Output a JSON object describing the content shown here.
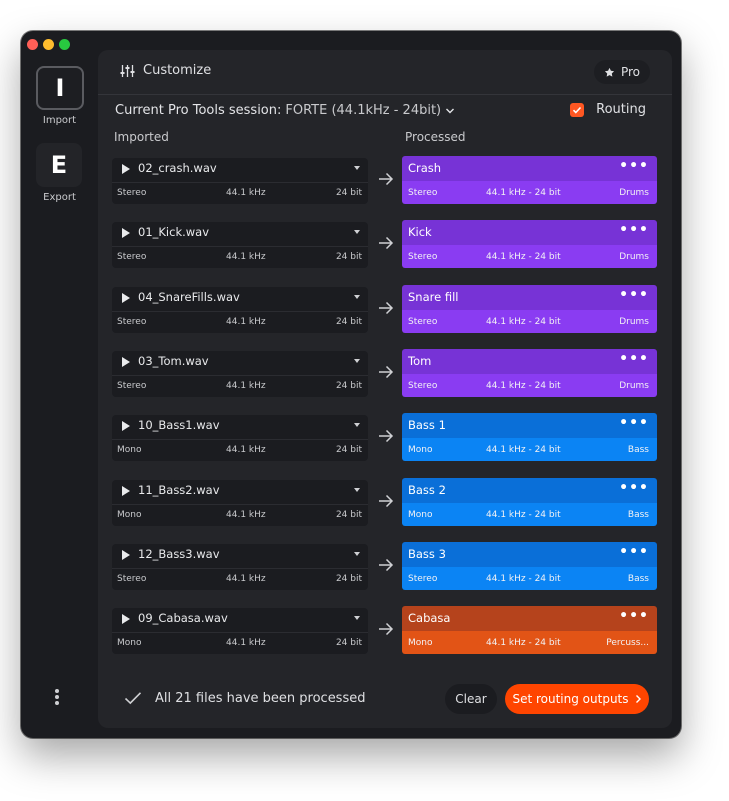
{
  "sidebar": {
    "import_glyph": "I",
    "import_label": "Import",
    "export_glyph": "E",
    "export_label": "Export",
    "more_icon": "vertical-dots"
  },
  "topbar": {
    "customize_label": "Customize",
    "customize_icon": "sliders-icon",
    "pro_label": "Pro",
    "pro_icon": "star-icon"
  },
  "session": {
    "label": "Current Pro Tools session:",
    "name": "FORTE (44.1kHz - 24bit)",
    "routing_label": "Routing",
    "routing_checked": true
  },
  "columns": {
    "imported": "Imported",
    "processed": "Processed"
  },
  "colors": {
    "drums_top": "#7733d6",
    "drums_bottom": "#8a3cf2",
    "bass_top": "#0a6fd8",
    "bass_bottom": "#0b84f4",
    "percussion_top": "#b5431c",
    "percussion_bottom": "#e25416",
    "accent": "#ff5722"
  },
  "rows": [
    {
      "file": "02_crash.wav",
      "ch": "Stereo",
      "rate": "44.1 kHz",
      "bits": "24 bit",
      "name": "Crash",
      "pch": "Stereo",
      "pfmt": "44.1 kHz - 24 bit",
      "group": "Drums",
      "color": "drums"
    },
    {
      "file": "01_Kick.wav",
      "ch": "Stereo",
      "rate": "44.1 kHz",
      "bits": "24 bit",
      "name": "Kick",
      "pch": "Stereo",
      "pfmt": "44.1 kHz - 24 bit",
      "group": "Drums",
      "color": "drums"
    },
    {
      "file": "04_SnareFills.wav",
      "ch": "Stereo",
      "rate": "44.1 kHz",
      "bits": "24 bit",
      "name": "Snare fill",
      "pch": "Stereo",
      "pfmt": "44.1 kHz - 24 bit",
      "group": "Drums",
      "color": "drums"
    },
    {
      "file": "03_Tom.wav",
      "ch": "Stereo",
      "rate": "44.1 kHz",
      "bits": "24 bit",
      "name": "Tom",
      "pch": "Stereo",
      "pfmt": "44.1 kHz - 24 bit",
      "group": "Drums",
      "color": "drums"
    },
    {
      "file": "10_Bass1.wav",
      "ch": "Mono",
      "rate": "44.1 kHz",
      "bits": "24 bit",
      "name": "Bass 1",
      "pch": "Mono",
      "pfmt": "44.1 kHz - 24 bit",
      "group": "Bass",
      "color": "bass"
    },
    {
      "file": "11_Bass2.wav",
      "ch": "Mono",
      "rate": "44.1 kHz",
      "bits": "24 bit",
      "name": "Bass 2",
      "pch": "Mono",
      "pfmt": "44.1 kHz - 24 bit",
      "group": "Bass",
      "color": "bass"
    },
    {
      "file": "12_Bass3.wav",
      "ch": "Stereo",
      "rate": "44.1 kHz",
      "bits": "24 bit",
      "name": "Bass 3",
      "pch": "Stereo",
      "pfmt": "44.1 kHz - 24 bit",
      "group": "Bass",
      "color": "bass"
    },
    {
      "file": "09_Cabasa.wav",
      "ch": "Mono",
      "rate": "44.1 kHz",
      "bits": "24 bit",
      "name": "Cabasa",
      "pch": "Mono",
      "pfmt": "44.1 kHz - 24 bit",
      "group": "Percuss...",
      "color": "percussion"
    }
  ],
  "footer": {
    "status": "All 21 files have been processed",
    "clear_label": "Clear",
    "route_label": "Set routing outputs"
  }
}
